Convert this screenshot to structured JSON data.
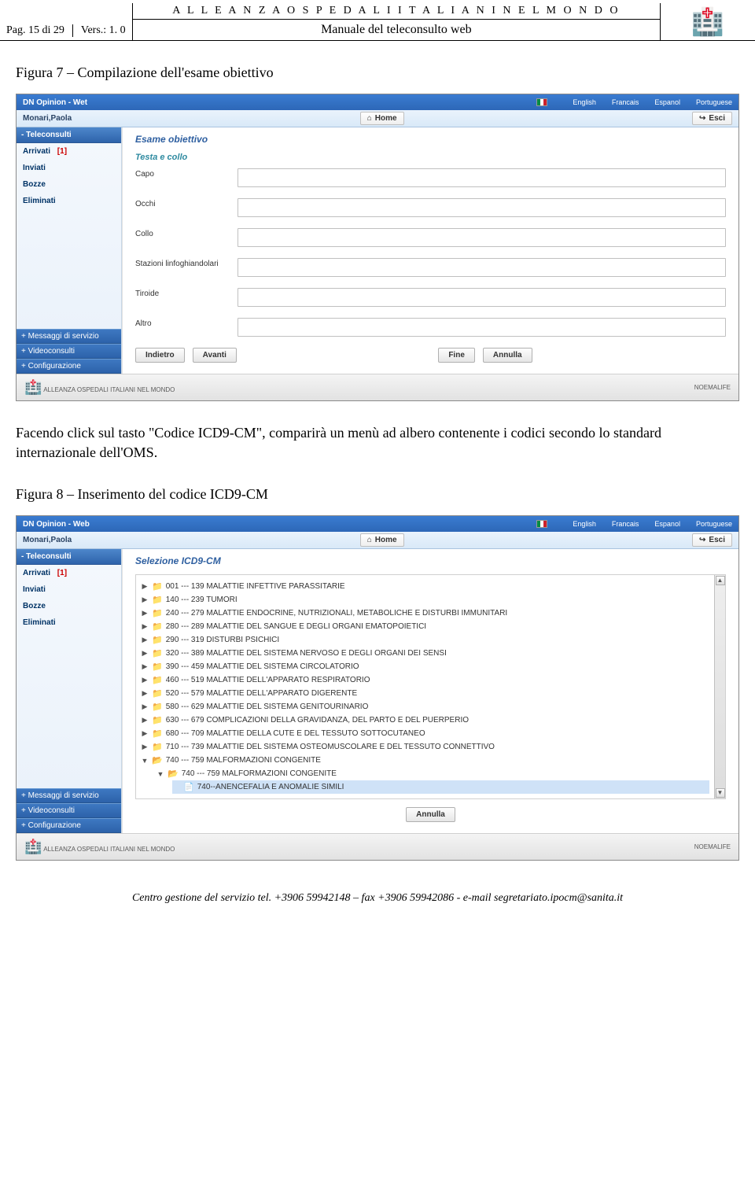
{
  "header": {
    "page_num": "Pag. 15 di 29",
    "vers": "Vers.: 1. 0",
    "org": "A L L E A N Z A   O S P E D A L I   I T A L I A N I   N E L   M O N D O",
    "manual": "Manuale del teleconsulto web"
  },
  "fig7_caption": "Figura 7 – Compilazione dell'esame obiettivo",
  "shot1": {
    "app": "DN Opinion - Wet",
    "langs": [
      "English",
      "Francais",
      "Espanol",
      "Portuguese"
    ],
    "user": "Monari,Paola",
    "home": "Home",
    "esci": "Esci",
    "side_head": "- Teleconsulti",
    "side_items": [
      {
        "label": "Arrivati",
        "count": "[1]"
      },
      {
        "label": "Inviati"
      },
      {
        "label": "Bozze"
      },
      {
        "label": "Eliminati"
      }
    ],
    "side_expand": [
      "+ Messaggi di servizio",
      "+ Videoconsulti",
      "+ Configurazione"
    ],
    "content_title": "Esame obiettivo",
    "section": "Testa e collo",
    "fields": [
      "Capo",
      "Occhi",
      "Collo",
      "Stazioni linfoghiandolari",
      "Tiroide",
      "Altro"
    ],
    "btns": {
      "indietro": "Indietro",
      "avanti": "Avanti",
      "fine": "Fine",
      "annulla": "Annulla"
    },
    "footlogo_left": "ALLEANZA OSPEDALI ITALIANI NEL MONDO",
    "footlogo_right": "NOEMALIFE"
  },
  "paragraph": "Facendo click sul tasto \"Codice ICD9-CM\", comparirà un menù ad albero contenente i codici secondo lo standard internazionale dell'OMS.",
  "fig8_caption": "Figura 8 – Inserimento del codice ICD9-CM",
  "shot2": {
    "app": "DN Opinion - Web",
    "content_title": "Selezione ICD9-CM",
    "tree": [
      "001 --- 139 MALATTIE INFETTIVE PARASSITARIE",
      "140 --- 239 TUMORI",
      "240 --- 279 MALATTIE ENDOCRINE, NUTRIZIONALI, METABOLICHE E DISTURBI IMMUNITARI",
      "280 --- 289 MALATTIE DEL SANGUE E DEGLI ORGANI EMATOPOIETICI",
      "290 --- 319 DISTURBI PSICHICI",
      "320 --- 389 MALATTIE DEL SISTEMA NERVOSO E DEGLI ORGANI DEI SENSI",
      "390 --- 459 MALATTIE DEL SISTEMA CIRCOLATORIO",
      "460 --- 519 MALATTIE DELL'APPARATO RESPIRATORIO",
      "520 --- 579 MALATTIE DELL'APPARATO DIGERENTE",
      "580 --- 629 MALATTIE DEL SISTEMA GENITOURINARIO",
      "630 --- 679 COMPLICAZIONI DELLA GRAVIDANZA, DEL PARTO E DEL PUERPERIO",
      "680 --- 709 MALATTIE DELLA CUTE E DEL TESSUTO SOTTOCUTANEO",
      "710 --- 739 MALATTIE DEL SISTEMA OSTEOMUSCOLARE E DEL TESSUTO CONNETTIVO"
    ],
    "tree_expanded": "740 --- 759 MALFORMAZIONI CONGENITE",
    "tree_sub": "740 --- 759 MALFORMAZIONI CONGENITE",
    "tree_leaf": "740--ANENCEFALIA E ANOMALIE SIMILI",
    "annulla": "Annulla"
  },
  "footer": "Centro gestione del servizio tel. +3906 59942148 – fax +3906 59942086 -  e-mail segretariato.ipocm@sanita.it"
}
